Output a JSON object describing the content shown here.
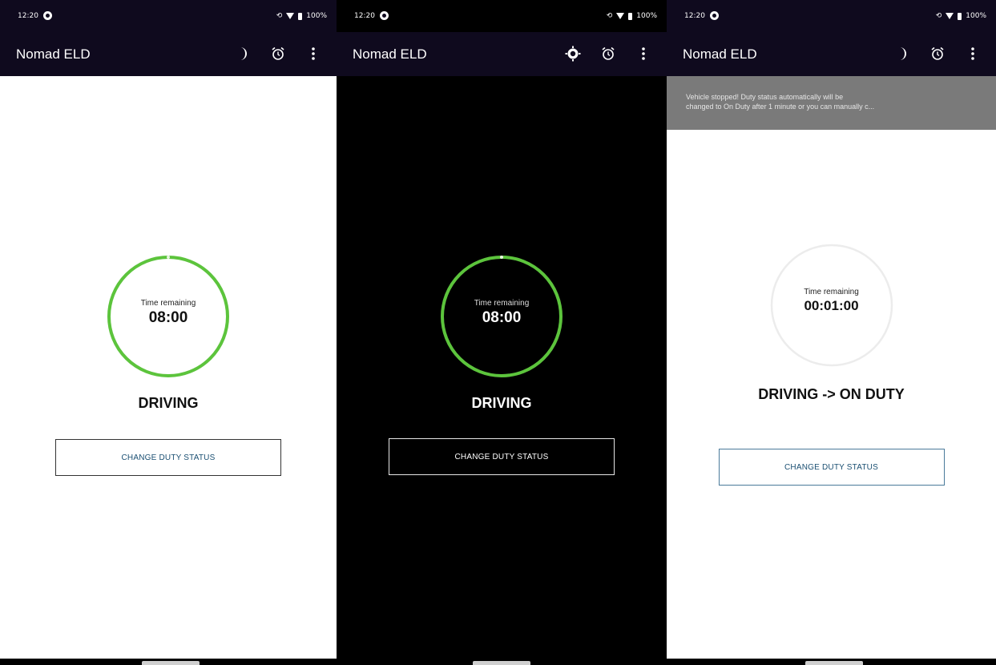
{
  "screens": [
    {
      "status_time": "12:20",
      "app_title": "Nomad ELD",
      "theme_icon": "moon-icon",
      "ring_label": "Time remaining",
      "ring_value": "08:00",
      "ring_progress": 1.0,
      "duty_status": "DRIVING",
      "button_label": "CHANGE DUTY STATUS"
    },
    {
      "status_time": "12:20",
      "app_title": "Nomad ELD",
      "theme_icon": "sun-icon",
      "ring_label": "Time remaining",
      "ring_value": "08:00",
      "ring_progress": 1.0,
      "duty_status": "DRIVING",
      "button_label": "CHANGE DUTY STATUS"
    },
    {
      "status_time": "12:20",
      "app_title": "Nomad ELD",
      "theme_icon": "moon-icon",
      "banner_line1": "Vehicle stopped! Duty status automatically will be",
      "banner_line2": "changed to On Duty after 1 minute or you can manually c...",
      "ring_label": "Time remaining",
      "ring_value": "00:01:00",
      "ring_progress": 0.0,
      "duty_status": "DRIVING -> ON DUTY",
      "button_label": "CHANGE DUTY STATUS"
    }
  ],
  "battery": "100%",
  "colors": {
    "toolbar_bg": "#0f0a1e",
    "ring_green": "#5cc43c",
    "ring_gray": "#ececec",
    "banner_bg": "#7a7a7a",
    "button_text_light": "#1a4f72"
  }
}
